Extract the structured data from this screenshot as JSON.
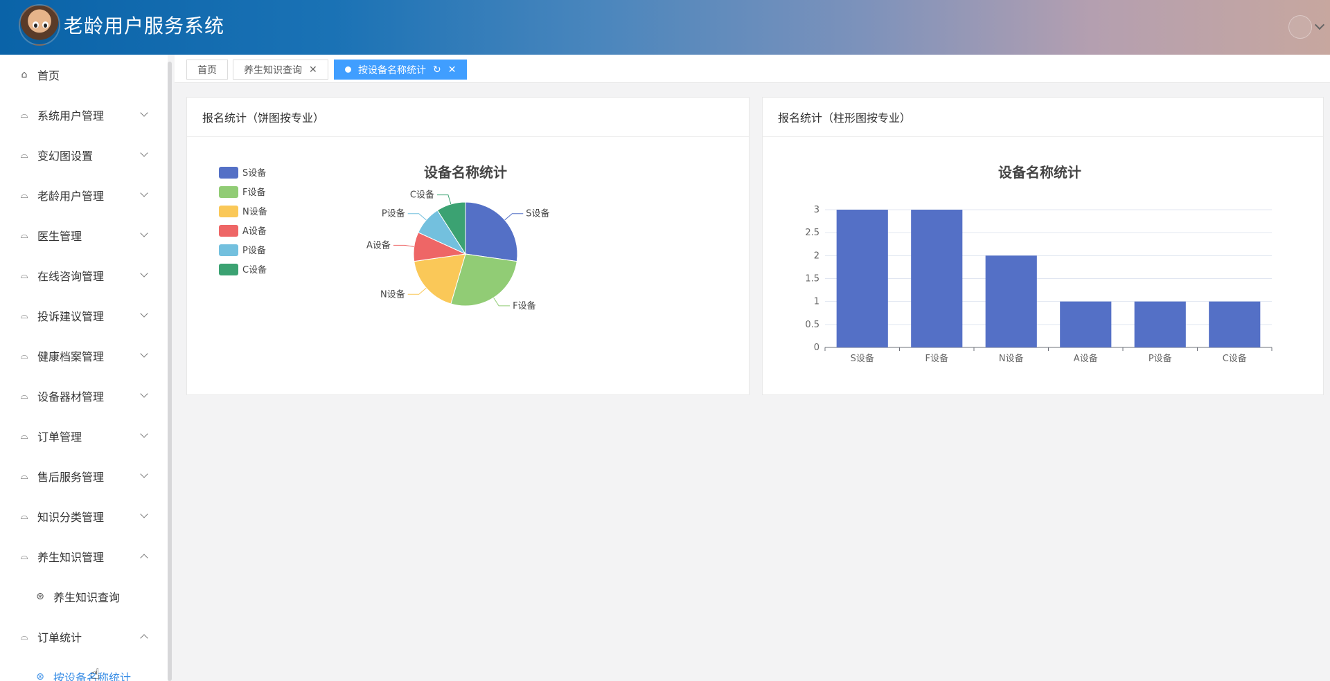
{
  "app": {
    "title": "老龄用户服务系统"
  },
  "sidebar": {
    "items": [
      {
        "label": "首页",
        "icon": "home-icon",
        "chevron": "none"
      },
      {
        "label": "系统用户管理",
        "icon": "menu-icon",
        "chevron": "down"
      },
      {
        "label": "变幻图设置",
        "icon": "menu-icon",
        "chevron": "down"
      },
      {
        "label": "老龄用户管理",
        "icon": "menu-icon",
        "chevron": "down"
      },
      {
        "label": "医生管理",
        "icon": "menu-icon",
        "chevron": "down"
      },
      {
        "label": "在线咨询管理",
        "icon": "menu-icon",
        "chevron": "down"
      },
      {
        "label": "投诉建议管理",
        "icon": "menu-icon",
        "chevron": "down"
      },
      {
        "label": "健康档案管理",
        "icon": "menu-icon",
        "chevron": "down"
      },
      {
        "label": "设备器材管理",
        "icon": "menu-icon",
        "chevron": "down"
      },
      {
        "label": "订单管理",
        "icon": "menu-icon",
        "chevron": "down"
      },
      {
        "label": "售后服务管理",
        "icon": "menu-icon",
        "chevron": "down"
      },
      {
        "label": "知识分类管理",
        "icon": "menu-icon",
        "chevron": "down"
      },
      {
        "label": "养生知识管理",
        "icon": "menu-icon",
        "chevron": "up"
      },
      {
        "label": "养生知识查询",
        "icon": "dribbble-icon",
        "sub": true
      },
      {
        "label": "订单统计",
        "icon": "menu-icon",
        "chevron": "up"
      },
      {
        "label": "按设备名称统计",
        "icon": "dribbble-icon",
        "sub": true,
        "active": true
      }
    ]
  },
  "tabs": [
    {
      "label": "首页"
    },
    {
      "label": "养生知识查询"
    },
    {
      "label": "按设备名称统计",
      "active": true
    }
  ],
  "cards": {
    "pie_title": "报名统计（饼图按专业）",
    "bar_title": "报名统计（柱形图按专业）"
  },
  "colors": {
    "accent": "#409eff",
    "series": [
      "#5470c6",
      "#91cc75",
      "#fac858",
      "#ee6666",
      "#73c0de",
      "#3ba272"
    ]
  },
  "chart_data": [
    {
      "type": "pie",
      "title": "设备名称统计",
      "categories": [
        "S设备",
        "F设备",
        "N设备",
        "A设备",
        "P设备",
        "C设备"
      ],
      "values": [
        3,
        3,
        2,
        1,
        1,
        1
      ],
      "legend": "left"
    },
    {
      "type": "bar",
      "title": "设备名称统计",
      "categories": [
        "S设备",
        "F设备",
        "N设备",
        "A设备",
        "P设备",
        "C设备"
      ],
      "values": [
        3,
        3,
        2,
        1,
        1,
        1
      ],
      "ylim": [
        0,
        3
      ],
      "yticks": [
        "0",
        "0.5",
        "1",
        "1.5",
        "2",
        "2.5",
        "3"
      ],
      "grid": true
    }
  ]
}
